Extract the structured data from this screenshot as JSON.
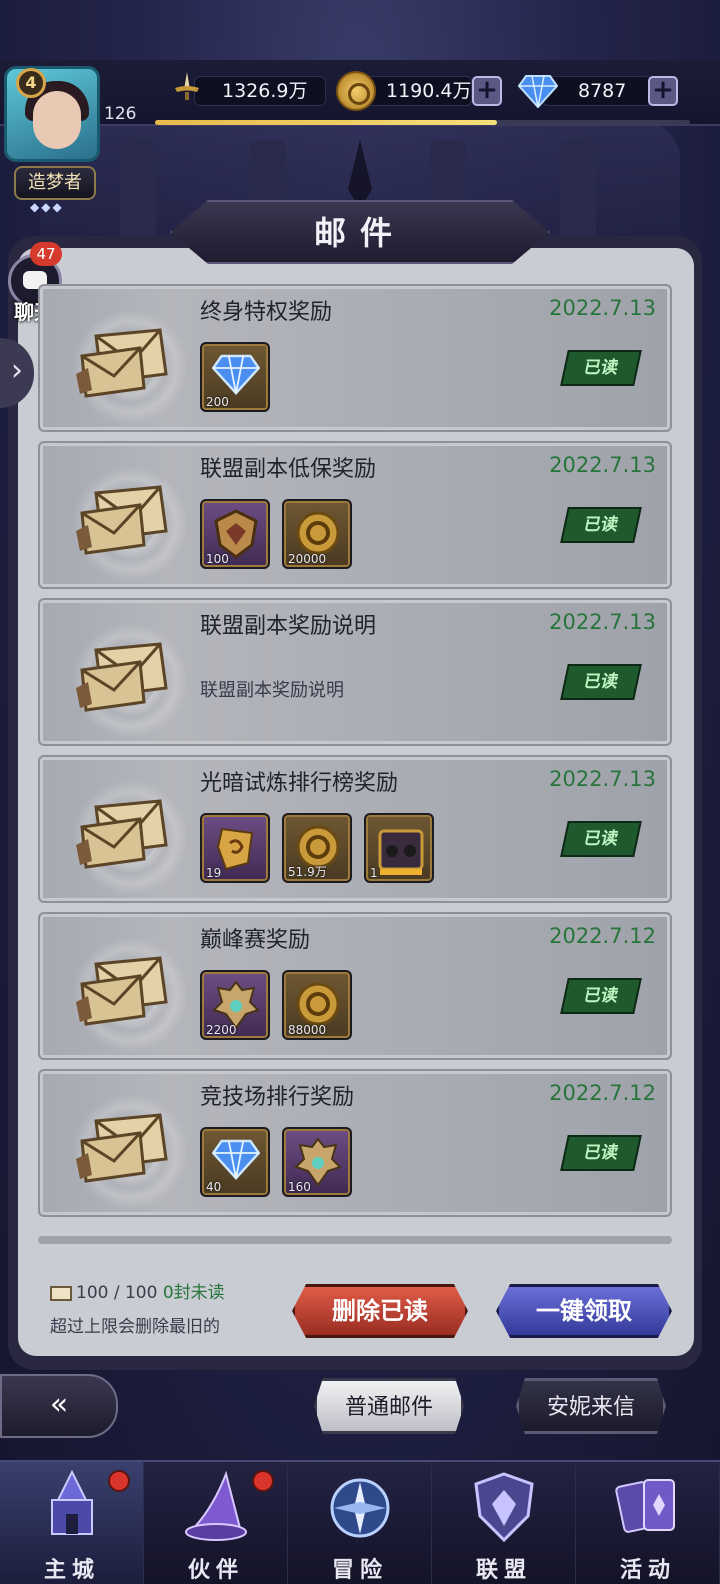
{
  "player": {
    "level": "4",
    "number": "126",
    "title": "造梦者",
    "title_stars": "◆◆◆",
    "exp_fraction": 0.64
  },
  "resources": {
    "power": "1326.9万",
    "gold": "1190.4万",
    "diamonds": "8787",
    "plus_label": "+"
  },
  "chat": {
    "badge": "47",
    "label": "聊天",
    "side_arrow": "›"
  },
  "panel": {
    "title": "邮件"
  },
  "mails": [
    {
      "title": "终身特权奖励",
      "date": "2022.7.13",
      "status": "已读",
      "text": "",
      "attachments": [
        {
          "icon": "diamond-icon",
          "qty": "200",
          "bg": "gold"
        }
      ]
    },
    {
      "title": "联盟副本低保奖励",
      "date": "2022.7.13",
      "status": "已读",
      "text": "",
      "attachments": [
        {
          "icon": "alliance-crest-icon",
          "qty": "100",
          "bg": "purple"
        },
        {
          "icon": "gold-coin-icon",
          "qty": "20000",
          "bg": "gold"
        }
      ]
    },
    {
      "title": "联盟副本奖励说明",
      "date": "2022.7.13",
      "status": "已读",
      "text": "联盟副本奖励说明",
      "attachments": []
    },
    {
      "title": "光暗试炼排行榜奖励",
      "date": "2022.7.13",
      "status": "已读",
      "text": "",
      "attachments": [
        {
          "icon": "rune-fragment-icon",
          "qty": "19",
          "bg": "purple"
        },
        {
          "icon": "gold-coin-icon",
          "qty": "51.9万",
          "bg": "gold"
        },
        {
          "icon": "treasure-chest-icon",
          "qty": "1",
          "bg": "gold"
        }
      ]
    },
    {
      "title": "巅峰赛奖励",
      "date": "2022.7.12",
      "status": "已读",
      "text": "",
      "attachments": [
        {
          "icon": "peak-crest-icon",
          "qty": "2200",
          "bg": "purple"
        },
        {
          "icon": "gold-coin-icon",
          "qty": "88000",
          "bg": "gold"
        }
      ]
    },
    {
      "title": "竞技场排行奖励",
      "date": "2022.7.12",
      "status": "已读",
      "text": "",
      "attachments": [
        {
          "icon": "diamond-icon",
          "qty": "40",
          "bg": "gold"
        },
        {
          "icon": "peak-crest-icon",
          "qty": "160",
          "bg": "purple"
        }
      ]
    }
  ],
  "footer": {
    "count": "100 / 100",
    "unread": "0封未读",
    "note": "超过上限会删除最旧的",
    "delete_read": "删除已读",
    "claim_all": "一键领取"
  },
  "mail_tabs": {
    "normal": "普通邮件",
    "anni": "安妮来信"
  },
  "back_label": "«",
  "nav": [
    {
      "label": "主城",
      "icon": "castle-icon",
      "dot": true
    },
    {
      "label": "伙伴",
      "icon": "wizard-hat-icon",
      "dot": true
    },
    {
      "label": "冒险",
      "icon": "compass-icon",
      "dot": false
    },
    {
      "label": "联盟",
      "icon": "shield-icon",
      "dot": false
    },
    {
      "label": "活动",
      "icon": "cards-icon",
      "dot": false
    }
  ],
  "colors": {
    "date_green": "#27753b",
    "delete_red": "#c0392b",
    "claim_blue": "#4a4fc0",
    "panel_bg": "#c9ccd3"
  }
}
